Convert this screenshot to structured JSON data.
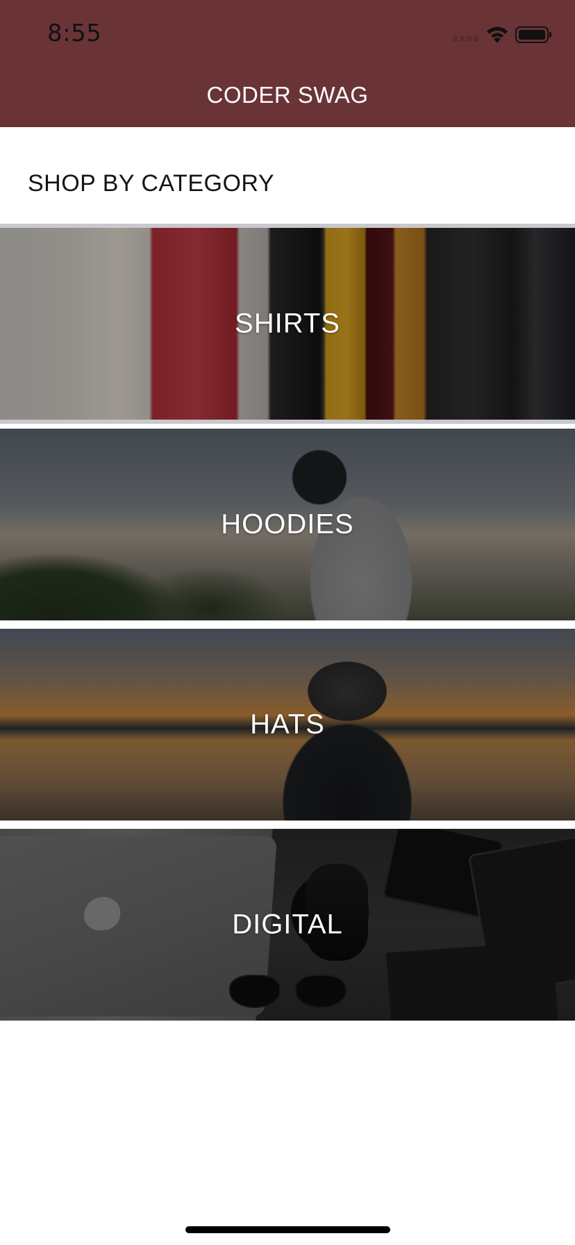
{
  "status_bar": {
    "time": "8:55",
    "icons": [
      "signal-icon",
      "wifi-icon",
      "battery-icon"
    ]
  },
  "nav": {
    "title": "CODER SWAG",
    "background_color": "#6a3436"
  },
  "section": {
    "header": "SHOP BY CATEGORY"
  },
  "categories": [
    {
      "label": "SHIRTS",
      "image": "shirts-image"
    },
    {
      "label": "HOODIES",
      "image": "hoodies-image"
    },
    {
      "label": "HATS",
      "image": "hats-image"
    },
    {
      "label": "DIGITAL",
      "image": "digital-image"
    }
  ]
}
